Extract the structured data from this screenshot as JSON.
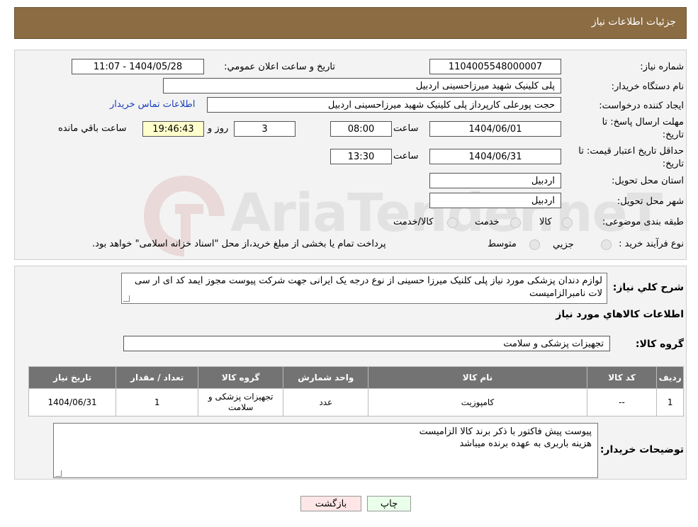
{
  "header": {
    "title": "جزئیات اطلاعات نیاز"
  },
  "watermark": "AriaTender.neT",
  "fields": {
    "need_number_label": "شماره نیاز:",
    "need_number": "1104005548000007",
    "announce_label": "تاریخ و ساعت اعلان عمومي:",
    "announce_value": "1404/05/28 - 11:07",
    "buyer_org_label": "نام دستگاه خريدار:",
    "buyer_org": "پلی کلینیک شهید میرزاحسینی اردبیل",
    "requester_label": "ايجاد كننده درخواست:",
    "requester": "حجت پورعلی کارپرداز  پلی کلینیک شهید میرزاحسینی اردبیل",
    "contact_link": "اطلاعات تماس خريدار",
    "deadline_label_1": "مهلت ارسال پاسخ: تا",
    "deadline_label_2": "تاریخ:",
    "deadline_date": "1404/06/01",
    "time_label": "ساعت",
    "deadline_time": "08:00",
    "days_value": "3",
    "days_label": "روز و",
    "remaining_time": "19:46:43",
    "remaining_label": "ساعت باقي مانده",
    "validity_label_1": "حداقل تاريخ اعتبار قيمت: تا",
    "validity_label_2": "تاريخ:",
    "validity_date": "1404/06/31",
    "validity_time": "13:30",
    "province_label": "استان محل تحویل:",
    "province": "اردبیل",
    "city_label": "شهر محل تحویل:",
    "city": "اردبیل",
    "category_label": "طبقه بندی موضوعی:",
    "category_options": [
      "کالا",
      "خدمت",
      "کالا/خدمت"
    ],
    "process_label": "نوع فرآيند خريد :",
    "process_options": [
      "جزيي",
      "متوسط"
    ],
    "process_note": "پرداخت تمام یا بخشی از مبلغ خرید،از محل \"اسناد خزانه اسلامی\" خواهد بود."
  },
  "description": {
    "label": "شرح کلي نياز:",
    "text": "لوازم دندان پزشکی مورد نیاز پلی کلنیک میرزا حسینی از نوع درجه یک ایرانی جهت شرکت پیوست مجوز ایمد کد ای ار سی لات نامبرالزامیست"
  },
  "goods": {
    "section_title": "اطلاعات کالاهاي مورد نياز",
    "group_label": "گروه کالا:",
    "group_value": "تجهیزات پزشکی و سلامت",
    "columns": [
      "رديف",
      "کد کالا",
      "نام کالا",
      "واحد شمارش",
      "گروه کالا",
      "تعداد / مقدار",
      "تاريخ نياز"
    ],
    "rows": [
      {
        "row": "1",
        "code": "--",
        "name": "کامپوزیت",
        "unit": "عدد",
        "group": "تجهیزات پزشکی و سلامت",
        "qty": "1",
        "date": "1404/06/31"
      }
    ]
  },
  "buyer_notes": {
    "label": "توضيحات خريدار:",
    "line1": "پیوست پیش فاکتور با ذکر برند کالا الزامیست",
    "line2": "هزینه باربری به عهده برنده میباشد"
  },
  "buttons": {
    "print": "چاپ",
    "back": "بازگشت"
  },
  "colors": {
    "header_bg": "#8b6c43",
    "table_header": "#737373",
    "print_btn": "#eaffea",
    "back_btn": "#ffe6e6"
  }
}
